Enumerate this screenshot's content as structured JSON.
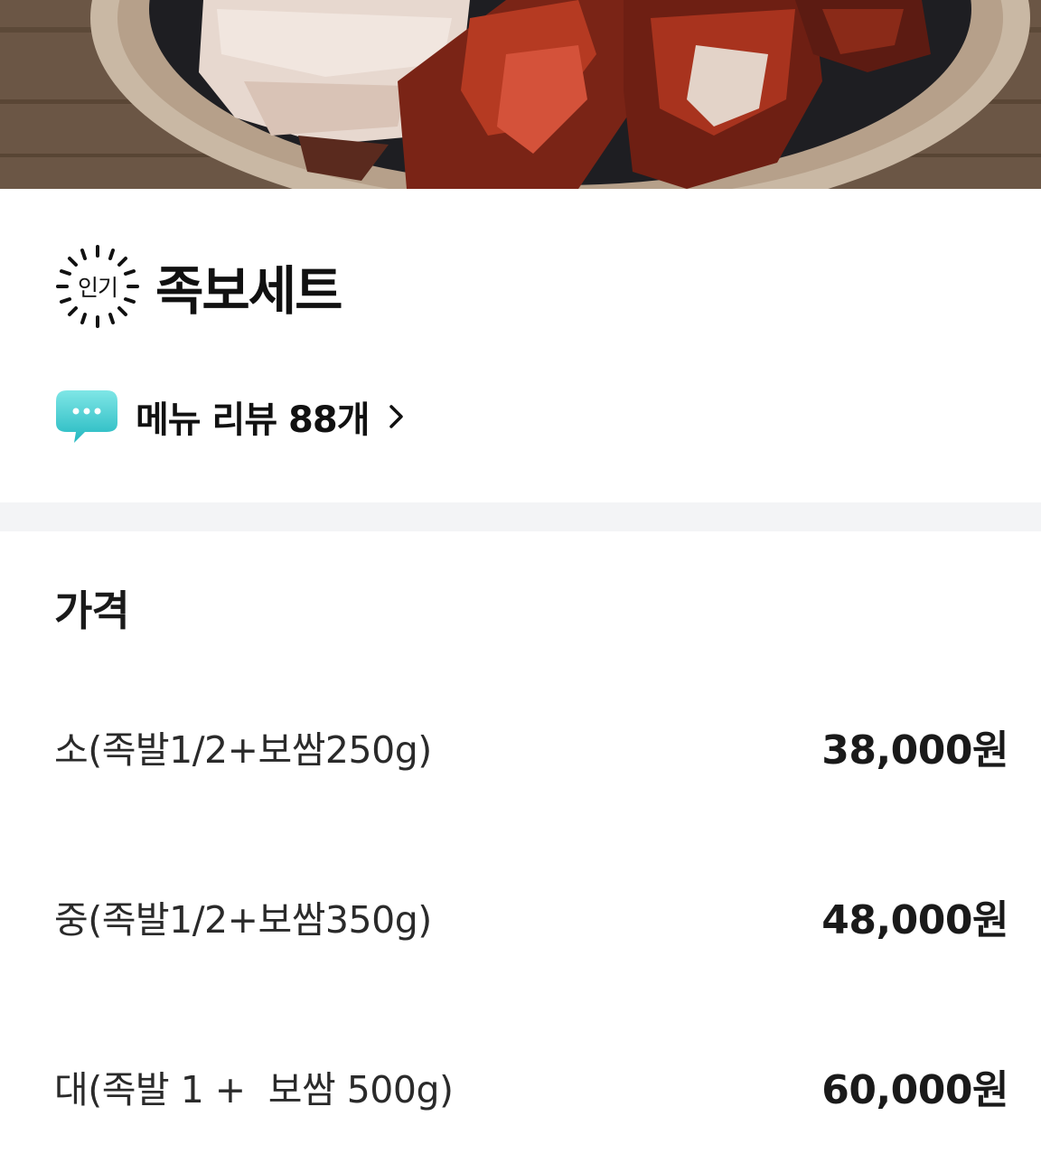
{
  "hero": {
    "image_icon": "food-photo"
  },
  "menu": {
    "badge_label": "인기",
    "title": "족보세트"
  },
  "review": {
    "icon": "speech-bubble-icon",
    "label": "메뉴 리뷰 88개"
  },
  "price": {
    "heading": "가격",
    "options": [
      {
        "label": "소(족발1/2+보쌈250g)",
        "price": "38,000원"
      },
      {
        "label": "중(족발1/2+보쌈350g)",
        "price": "48,000원"
      },
      {
        "label": "대(족발 1 +  보쌈 500g)",
        "price": "60,000원"
      }
    ]
  },
  "colors": {
    "accent_bubble": "#3ccfcf",
    "divider": "#f3f4f6",
    "text_primary": "#1a1a1a"
  }
}
